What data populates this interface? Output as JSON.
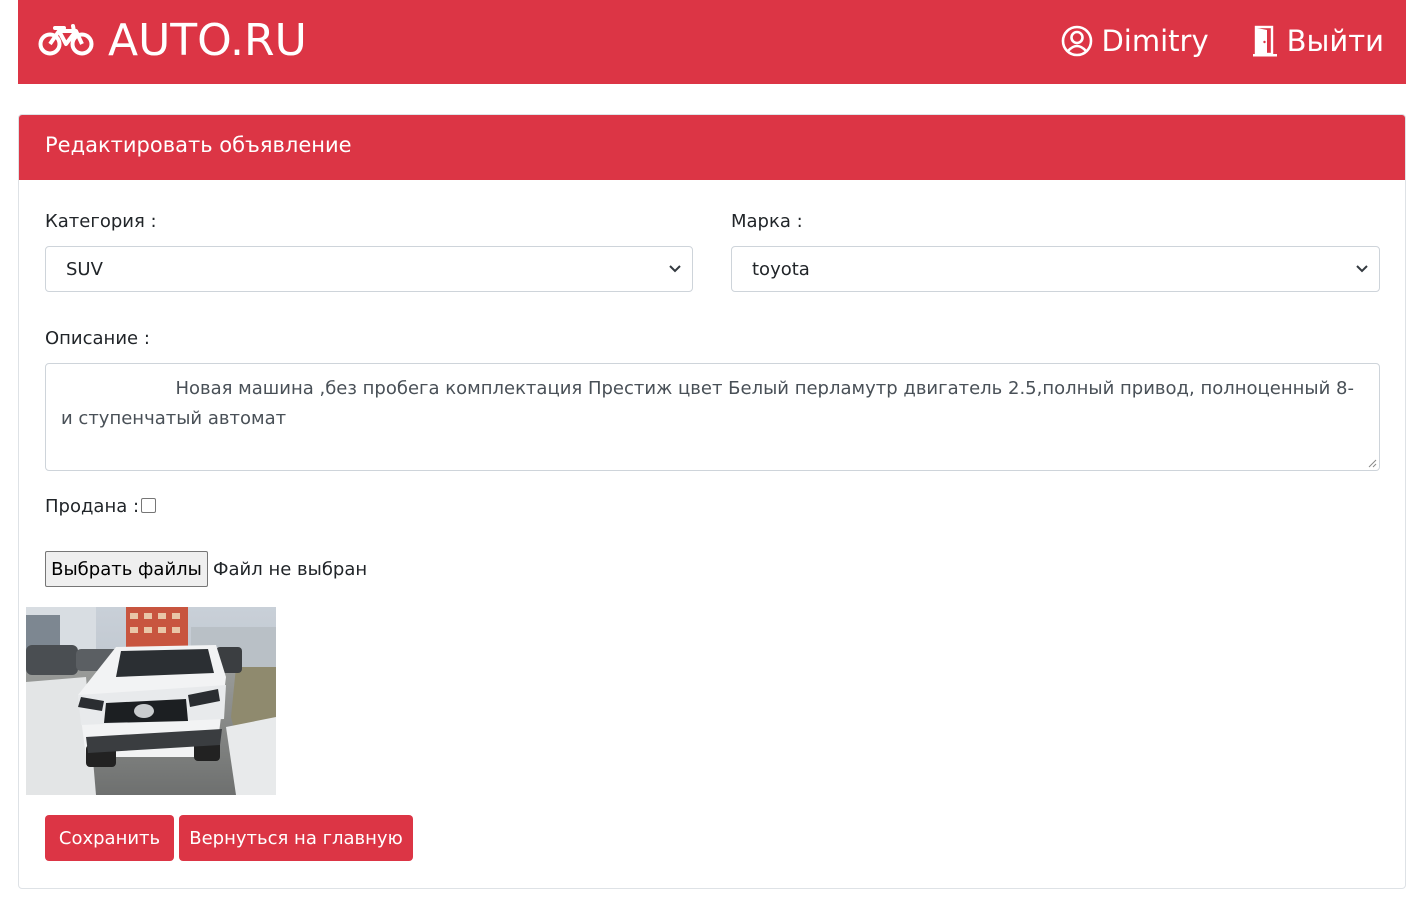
{
  "brand": {
    "name": "AUTO.RU",
    "icon": "bicycle-icon"
  },
  "nav": {
    "user_name": "Dimitry",
    "user_icon": "user-circle-icon",
    "logout_label": "Выйти",
    "logout_icon": "door-exit-icon"
  },
  "form": {
    "title": "Редактировать объявление",
    "category_label": "Категория :",
    "category_value": "SUV",
    "brand_label": "Марка :",
    "brand_value": "toyota",
    "description_label": "Описание :",
    "description_value": "                    Новая машина ,без пробега комплектация Престиж цвет Белый перламутр двигатель 2.5,полный привод, полноценный 8-и ступенчатый автомат",
    "sold_label": "Продана :",
    "sold_checked": false,
    "file_button_label": "Выбрать файлы",
    "file_status": "Файл не выбран",
    "save_label": "Сохранить",
    "back_label": "Вернуться на главную"
  },
  "colors": {
    "accent": "#dc3545",
    "border": "#ced4da"
  }
}
